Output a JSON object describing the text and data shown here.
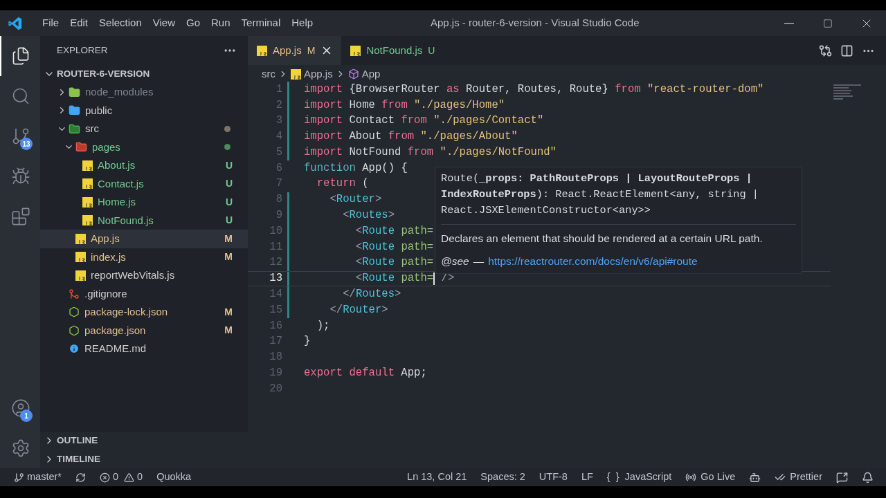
{
  "window": {
    "title": "App.js - router-6-version - Visual Studio Code"
  },
  "menu": [
    "File",
    "Edit",
    "Selection",
    "View",
    "Go",
    "Run",
    "Terminal",
    "Help"
  ],
  "activity_bar": [
    {
      "kind": "files",
      "selected": true
    },
    {
      "kind": "search",
      "selected": false
    },
    {
      "kind": "source-control",
      "selected": false,
      "badge": "13"
    },
    {
      "kind": "debug",
      "selected": false
    },
    {
      "kind": "extensions",
      "selected": false
    }
  ],
  "activity_bottom": [
    {
      "kind": "account",
      "badge": "1"
    },
    {
      "kind": "settings"
    }
  ],
  "sidebar": {
    "title": "EXPLORER",
    "project": "ROUTER-6-VERSION",
    "expanded": true,
    "items": [
      {
        "name": "node_modules",
        "kind": "folder-node",
        "expanded": false,
        "ignored": true,
        "selected": false
      },
      {
        "name": "public",
        "kind": "folder-public",
        "expanded": false,
        "selected": false
      },
      {
        "name": "src",
        "kind": "folder-src",
        "expanded": true,
        "selected": false,
        "color": "#7d7466",
        "children": [
          {
            "name": "pages",
            "kind": "folder-pages",
            "expanded": true,
            "selected": false,
            "untracked": true,
            "color": "#4e8a5c",
            "children": [
              {
                "name": "About.js",
                "kind": "js",
                "untracked": true,
                "badge": "U",
                "selected": false
              },
              {
                "name": "Contact.js",
                "kind": "js",
                "untracked": true,
                "badge": "U",
                "selected": false
              },
              {
                "name": "Home.js",
                "kind": "js",
                "untracked": true,
                "badge": "U",
                "selected": false
              },
              {
                "name": "NotFound.js",
                "kind": "js",
                "untracked": true,
                "badge": "U",
                "selected": false
              }
            ]
          },
          {
            "name": "App.js",
            "kind": "js",
            "untracked": false,
            "badge": "M",
            "selected": true
          },
          {
            "name": "index.js",
            "kind": "js",
            "untracked": false,
            "badge": "M",
            "selected": false
          },
          {
            "name": "reportWebVitals.js",
            "kind": "js",
            "selected": false
          }
        ]
      },
      {
        "name": ".gitignore",
        "kind": "git",
        "selected": false
      },
      {
        "name": "package-lock.json",
        "kind": "node",
        "untracked": false,
        "badge": "M",
        "selected": false
      },
      {
        "name": "package.json",
        "kind": "node",
        "untracked": false,
        "badge": "M",
        "selected": false
      },
      {
        "name": "README.md",
        "kind": "info",
        "selected": false
      }
    ],
    "sections": [
      {
        "label": "OUTLINE",
        "expanded": false
      },
      {
        "label": "TIMELINE",
        "expanded": false
      }
    ]
  },
  "tabs": [
    {
      "label": "App.js",
      "badge": "M",
      "untracked": false,
      "selected": true
    },
    {
      "label": "NotFound.js",
      "badge": "U",
      "untracked": true,
      "selected": false
    }
  ],
  "breadcrumb": [
    "src",
    "App.js",
    "App"
  ],
  "code": [
    {
      "n": "1",
      "changed": true,
      "current": false,
      "tokens": [
        {
          "kind": "kw",
          "t": "import"
        },
        {
          "kind": "id",
          "t": " {BrowserRouter "
        },
        {
          "kind": "kw",
          "t": "as"
        },
        {
          "kind": "id",
          "t": " Router, Routes, Route} "
        },
        {
          "kind": "kw",
          "t": "from"
        },
        {
          "kind": "str",
          "t": " \"react-router-dom\""
        }
      ]
    },
    {
      "n": "2",
      "changed": true,
      "current": false,
      "tokens": [
        {
          "kind": "kw",
          "t": "import"
        },
        {
          "kind": "id",
          "t": " Home "
        },
        {
          "kind": "kw",
          "t": "from"
        },
        {
          "kind": "str",
          "t": " \"./pages/Home\""
        }
      ]
    },
    {
      "n": "3",
      "changed": true,
      "current": false,
      "tokens": [
        {
          "kind": "kw",
          "t": "import"
        },
        {
          "kind": "id",
          "t": " Contact "
        },
        {
          "kind": "kw",
          "t": "from"
        },
        {
          "kind": "str",
          "t": " \"./pages/Contact\""
        }
      ]
    },
    {
      "n": "4",
      "changed": true,
      "current": false,
      "tokens": [
        {
          "kind": "kw",
          "t": "import"
        },
        {
          "kind": "id",
          "t": " About "
        },
        {
          "kind": "kw",
          "t": "from"
        },
        {
          "kind": "str",
          "t": " \"./pages/About\""
        }
      ]
    },
    {
      "n": "5",
      "changed": true,
      "current": false,
      "tokens": [
        {
          "kind": "kw",
          "t": "import"
        },
        {
          "kind": "id",
          "t": " NotFound "
        },
        {
          "kind": "kw",
          "t": "from"
        },
        {
          "kind": "str",
          "t": " \"./pages/NotFound\""
        }
      ]
    },
    {
      "n": "6",
      "changed": false,
      "current": false,
      "tokens": [
        {
          "kind": "fn",
          "t": "function"
        },
        {
          "kind": "id",
          "t": " App() {"
        }
      ]
    },
    {
      "n": "7",
      "changed": false,
      "current": false,
      "tokens": [
        {
          "kind": "kw",
          "t": "  return"
        },
        {
          "kind": "id",
          "t": " ("
        }
      ]
    },
    {
      "n": "8",
      "changed": true,
      "current": false,
      "tokens": [
        {
          "kind": "punct",
          "t": "    <"
        },
        {
          "kind": "tag",
          "t": "Router"
        },
        {
          "kind": "punct",
          "t": ">"
        }
      ]
    },
    {
      "n": "9",
      "changed": true,
      "current": false,
      "tokens": [
        {
          "kind": "punct",
          "t": "      <"
        },
        {
          "kind": "tag",
          "t": "Routes"
        },
        {
          "kind": "punct",
          "t": ">"
        }
      ]
    },
    {
      "n": "10",
      "changed": true,
      "current": false,
      "tokens": [
        {
          "kind": "punct",
          "t": "        <"
        },
        {
          "kind": "tag",
          "t": "Route"
        },
        {
          "kind": "attr",
          "t": " path="
        }
      ]
    },
    {
      "n": "11",
      "changed": true,
      "current": false,
      "tokens": [
        {
          "kind": "punct",
          "t": "        <"
        },
        {
          "kind": "tag",
          "t": "Route"
        },
        {
          "kind": "attr",
          "t": " path="
        }
      ]
    },
    {
      "n": "12",
      "changed": true,
      "current": false,
      "tokens": [
        {
          "kind": "punct",
          "t": "        <"
        },
        {
          "kind": "tag",
          "t": "Route"
        },
        {
          "kind": "attr",
          "t": " path="
        }
      ]
    },
    {
      "n": "13",
      "changed": true,
      "current": true,
      "tokens": [
        {
          "kind": "punct",
          "t": "        <"
        },
        {
          "kind": "tag",
          "t": "Route"
        },
        {
          "kind": "attr",
          "t": " path="
        },
        {
          "kind": "cursor"
        },
        {
          "kind": "punct",
          "t": " />"
        }
      ]
    },
    {
      "n": "14",
      "changed": true,
      "current": false,
      "tokens": [
        {
          "kind": "punct",
          "t": "      </"
        },
        {
          "kind": "tag",
          "t": "Routes"
        },
        {
          "kind": "punct",
          "t": ">"
        }
      ]
    },
    {
      "n": "15",
      "changed": true,
      "current": false,
      "tokens": [
        {
          "kind": "punct",
          "t": "    </"
        },
        {
          "kind": "tag",
          "t": "Router"
        },
        {
          "kind": "punct",
          "t": ">"
        }
      ]
    },
    {
      "n": "16",
      "changed": false,
      "current": false,
      "tokens": [
        {
          "kind": "id",
          "t": "  );"
        }
      ]
    },
    {
      "n": "17",
      "changed": false,
      "current": false,
      "tokens": [
        {
          "kind": "id",
          "t": "}"
        }
      ]
    },
    {
      "n": "18",
      "changed": false,
      "current": false
    },
    {
      "n": "19",
      "changed": false,
      "current": false,
      "tokens": [
        {
          "kind": "kw",
          "t": "export default"
        },
        {
          "kind": "id",
          "t": " App;"
        }
      ]
    },
    {
      "n": "20",
      "changed": false,
      "current": false
    }
  ],
  "hover": {
    "signature": "Route(**_props: PathRouteProps | LayoutRouteProps | IndexRouteProps**): React.ReactElement<any, string | React.JSXElementConstructor<any>>",
    "description": "Declares an element that should be rendered at a certain URL path.",
    "see_label": "@see",
    "see_dash": "—",
    "see_link": "https://reactrouter.com/docs/en/v6/api#route"
  },
  "status_bar": {
    "branch": "master*",
    "errors": "0",
    "warnings": "0",
    "left": [
      "Quokka"
    ],
    "right": [
      {
        "kind": "text",
        "label": "Ln 13, Col 21"
      },
      {
        "kind": "text",
        "label": "Spaces: 2"
      },
      {
        "kind": "text",
        "label": "UTF-8"
      },
      {
        "kind": "text",
        "label": "LF"
      },
      {
        "kind": "language",
        "label": "JavaScript",
        "glyph": "{ }"
      },
      {
        "kind": "golive",
        "label": "Go Live"
      },
      {
        "kind": "copilot"
      },
      {
        "kind": "prettier",
        "label": "Prettier"
      },
      {
        "kind": "feedback"
      },
      {
        "kind": "bell"
      }
    ]
  }
}
